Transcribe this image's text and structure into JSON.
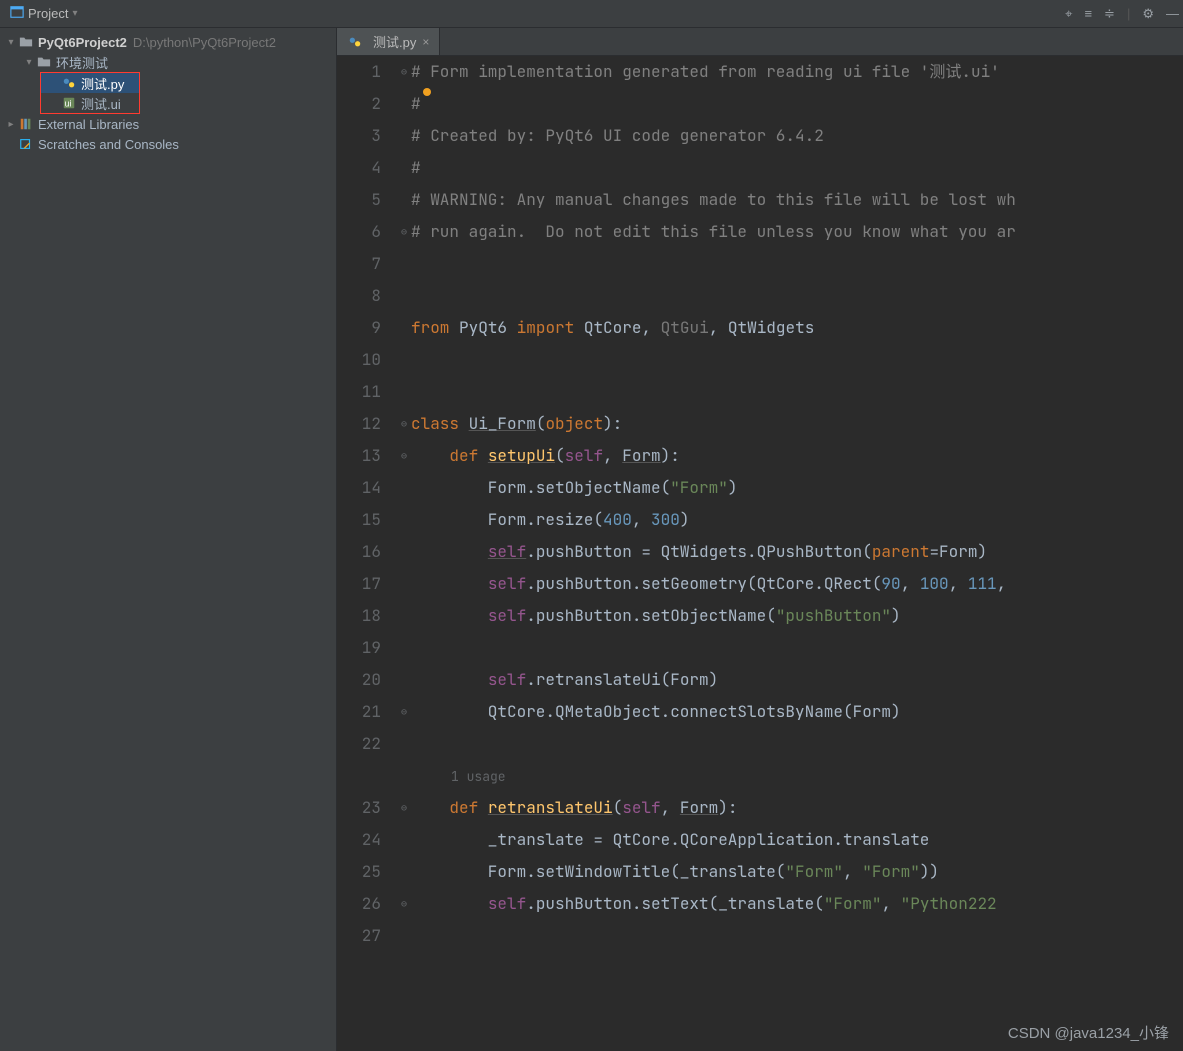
{
  "toolbar": {
    "project_label": "Project"
  },
  "tree": {
    "root_name": "PyQt6Project2",
    "root_path": "D:\\python\\PyQt6Project2",
    "folder1": "环境测试",
    "file_py": "测试.py",
    "file_ui": "测试.ui",
    "ext_libs": "External Libraries",
    "scratches": "Scratches and Consoles"
  },
  "tab": {
    "label": "测试.py"
  },
  "code": {
    "lines": [
      "# Form implementation generated from reading ui file '测试.ui'",
      "#",
      "# Created by: PyQt6 UI code generator 6.4.2",
      "#",
      "# WARNING: Any manual changes made to this file will be lost wh",
      "# run again.  Do not edit this file unless you know what you ar",
      "",
      "",
      "from PyQt6 import QtCore, QtGui, QtWidgets",
      "",
      "",
      "class Ui_Form(object):",
      "    def setupUi(self, Form):",
      "        Form.setObjectName(\"Form\")",
      "        Form.resize(400, 300)",
      "        self.pushButton = QtWidgets.QPushButton(parent=Form)",
      "        self.pushButton.setGeometry(QtCore.QRect(90, 100, 111,",
      "        self.pushButton.setObjectName(\"pushButton\")",
      "",
      "        self.retranslateUi(Form)",
      "        QtCore.QMetaObject.connectSlotsByName(Form)",
      "",
      "    def retranslateUi(self, Form):",
      "        _translate = QtCore.QCoreApplication.translate",
      "        Form.setWindowTitle(_translate(\"Form\", \"Form\"))",
      "        self.pushButton.setText(_translate(\"Form\", \"Python222 ",
      ""
    ],
    "inlay_usage": "1 usage"
  },
  "watermark": "CSDN @java1234_小锋"
}
